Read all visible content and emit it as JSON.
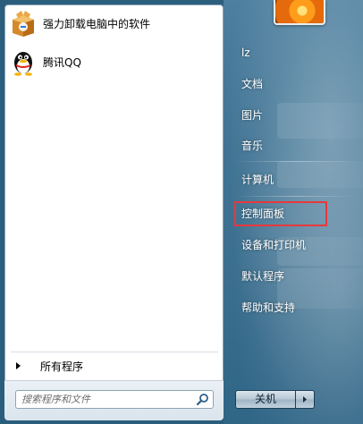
{
  "programs": [
    {
      "label": "强力卸载电脑中的软件",
      "icon": "uninstall-box-icon"
    },
    {
      "label": "腾讯QQ",
      "icon": "qq-penguin-icon"
    }
  ],
  "all_programs_label": "所有程序",
  "search": {
    "placeholder": "搜索程序和文件"
  },
  "right_menu": {
    "items": [
      "lz",
      "文档",
      "图片",
      "音乐",
      "计算机",
      "控制面板",
      "设备和打印机",
      "默认程序",
      "帮助和支持"
    ],
    "highlighted": "控制面板"
  },
  "shutdown": {
    "label": "关机"
  },
  "colors": {
    "highlight": "#e8383b"
  }
}
